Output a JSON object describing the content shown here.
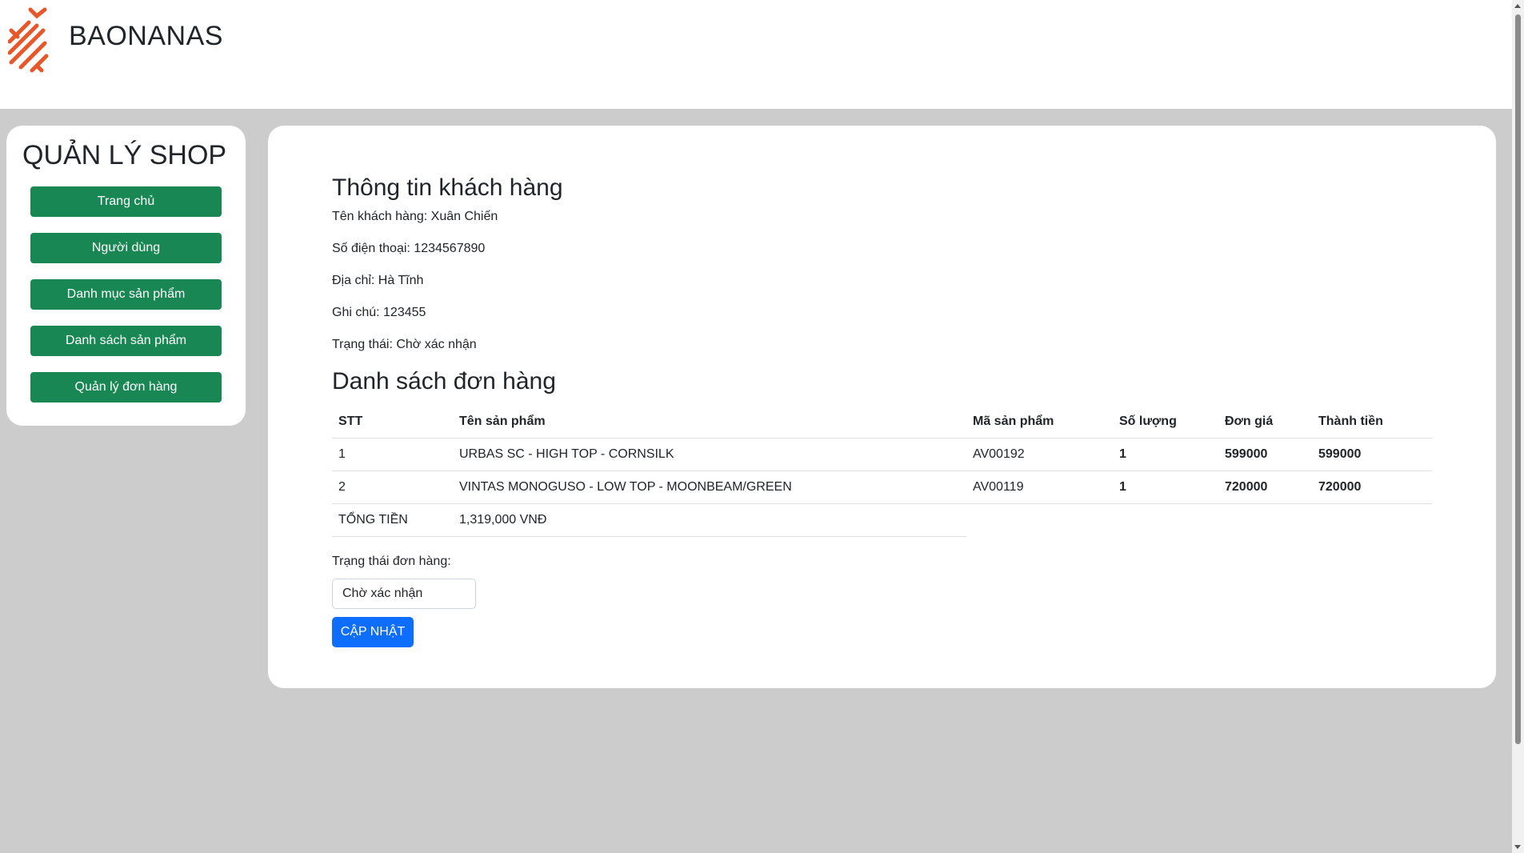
{
  "header": {
    "brand": "BAONANAS"
  },
  "sidebar": {
    "title": "QUẢN LÝ SHOP",
    "items": [
      {
        "label": "Trang chủ"
      },
      {
        "label": "Người dùng"
      },
      {
        "label": "Danh mục sản phẩm"
      },
      {
        "label": "Danh sách sản phẩm"
      },
      {
        "label": "Quản lý đơn hàng"
      }
    ]
  },
  "customer": {
    "heading": "Thông tin khách hàng",
    "name": "Tên khách hàng: Xuân Chiến",
    "phone": "Số điện thoại: 1234567890",
    "address": "Địa chỉ: Hà Tĩnh",
    "note": "Ghi chú: 123455",
    "status": "Trạng thái: Chờ xác nhận"
  },
  "orders": {
    "heading": "Danh sách đơn hàng",
    "columns": [
      "STT",
      "Tên sản phẩm",
      "Mã sản phẩm",
      "Số lượng",
      "Đơn giá",
      "Thành tiền"
    ],
    "rows": [
      {
        "stt": "1",
        "name": "URBAS SC - HIGH TOP - CORNSILK",
        "code": "AV00192",
        "qty": "1",
        "price": "599000",
        "total": "599000"
      },
      {
        "stt": "2",
        "name": "VINTAS MONOGUSO - LOW TOP - MOONBEAM/GREEN",
        "code": "AV00119",
        "qty": "1",
        "price": "720000",
        "total": "720000"
      }
    ],
    "total_label": "TỔNG TIỀN",
    "total_value": "1,319,000 VNĐ"
  },
  "form": {
    "status_label": "Trạng thái đơn hàng:",
    "status_value": "Chờ xác nhận",
    "update_label": "CẬP NHẬT"
  },
  "colors": {
    "nav_button": "#198754",
    "primary_button": "#0d6efd",
    "logo": "#e8572a",
    "background": "#cccccc"
  }
}
